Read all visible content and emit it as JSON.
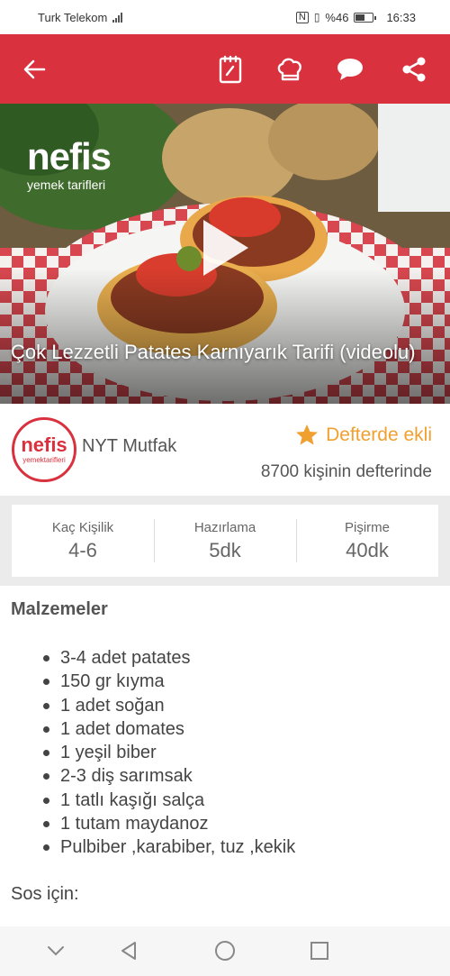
{
  "status_bar": {
    "carrier": "Turk Telekom",
    "network_icons": "4G signal",
    "battery_percent": "%46",
    "time": "16:33"
  },
  "app_bar": {
    "background_color": "#d9313d",
    "icons": [
      "back-arrow-icon",
      "notebook-icon",
      "chef-hat-icon",
      "comment-icon",
      "share-icon"
    ]
  },
  "hero": {
    "logo_text": "nefis",
    "logo_subtext": "yemek tarifleri",
    "title": "Çok Lezzetli Patates Karnıyarık Tarifi (videolu)"
  },
  "author": {
    "logo_text": "nefis",
    "logo_subtext": "yemektarifleri",
    "name": "NYT Mutfak",
    "saved_label": "Defterde ekli",
    "saved_count": "8700 kişinin defterinde",
    "accent_color": "#f0a030"
  },
  "info": {
    "servings_label": "Kaç Kişilik",
    "servings_value": "4-6",
    "prep_label": "Hazırlama",
    "prep_value": "5dk",
    "cook_label": "Pişirme",
    "cook_value": "40dk"
  },
  "ingredients": {
    "title": "Malzemeler",
    "items": [
      "3-4 adet patates",
      "150 gr kıyma",
      "1 adet soğan",
      "1 adet domates",
      "1 yeşil biber",
      "2-3 diş sarımsak",
      "1 tatlı kaşığı salça",
      "1 tutam maydanoz",
      "Pulbiber ,karabiber, tuz ,kekik"
    ],
    "sauce_label": "Sos için:"
  },
  "nav_bar": {
    "icons": [
      "chevron-down-icon",
      "back-triangle-icon",
      "home-circle-icon",
      "recents-square-icon"
    ]
  }
}
